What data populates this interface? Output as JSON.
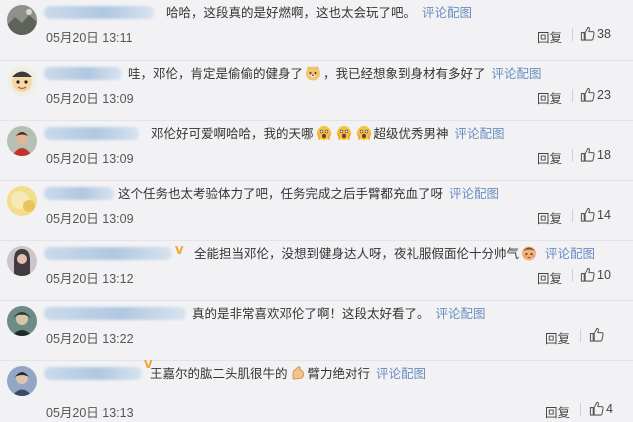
{
  "comments": [
    {
      "text": "哈哈，这段真的是好燃啊，这也太会玩了吧。",
      "pic_link": "评论配图",
      "time": "05月20日 13:11",
      "reply": "回复",
      "likes": "38",
      "avatar": "avatar-grey-landscape"
    },
    {
      "text_before": "哇，邓伦，肯定是偷偷的健身了",
      "emoji": "doge-emoji",
      "text_after": "，我已经想象到身材有多好了",
      "pic_link": "评论配图",
      "time": "05月20日 13:09",
      "reply": "回复",
      "likes": "23",
      "avatar": "avatar-cartoon-face"
    },
    {
      "text_before": "邓伦好可爱啊哈哈，我的天哪",
      "emoji": "shocked-face-emoji",
      "text_after": "超级优秀男神",
      "pic_link": "评论配图",
      "time": "05月20日 13:09",
      "reply": "回复",
      "likes": "18",
      "avatar": "avatar-person-red"
    },
    {
      "text": "这个任务也太考验体力了吧，任务完成之后手臂都充血了呀",
      "pic_link": "评论配图",
      "time": "05月20日 13:09",
      "reply": "回复",
      "likes": "14",
      "avatar": "avatar-yellow"
    },
    {
      "vip": "V",
      "text_before": "全能担当邓伦，没想到健身达人呀，夜礼服假面伦十分帅气",
      "emoji": "cute-blush-emoji",
      "pic_link": "评论配图",
      "time": "05月20日 13:12",
      "reply": "回复",
      "likes": "10",
      "avatar": "avatar-dark-girl"
    },
    {
      "text": "真的是非常喜欢邓伦了啊！这段太好看了。",
      "pic_link": "评论配图",
      "time": "05月20日 13:22",
      "reply": "回复",
      "likes": "0",
      "likes_visible": false,
      "avatar": "avatar-teal-character"
    },
    {
      "vip": "V",
      "text_before": "王嘉尔的肱二头肌很牛的",
      "emoji": "flexed-arm-emoji",
      "text_after": "臂力绝对行",
      "pic_link": "评论配图",
      "time": "05月20日 13:13",
      "reply": "回复",
      "likes": "4",
      "avatar": "avatar-blue-portrait"
    }
  ],
  "colors": {
    "link": "#6a8dbf",
    "background": "#f2f2f5",
    "vip": "#f3a52b"
  }
}
